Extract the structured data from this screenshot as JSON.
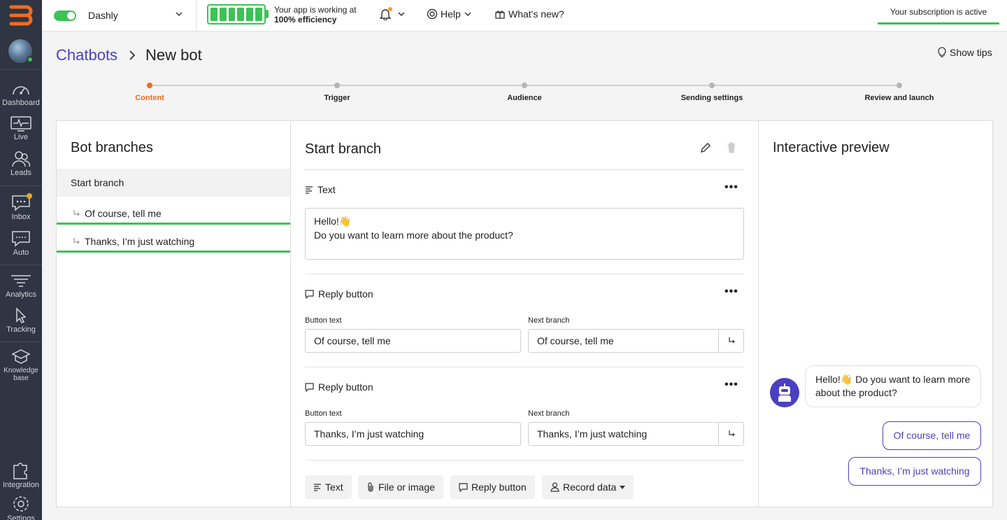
{
  "topbar": {
    "project_name": "Dashly",
    "efficiency_line1": "Your app is working at",
    "efficiency_line2": "100% efficiency",
    "help_label": "Help",
    "whats_new_label": "What's new?",
    "subscription_text": "Your subscription is active"
  },
  "sidebar": {
    "items": [
      {
        "label": "Dashboard",
        "icon": "speedometer-icon"
      },
      {
        "label": "Live",
        "icon": "pulse-monitor-icon"
      },
      {
        "label": "Leads",
        "icon": "users-icon"
      },
      {
        "label": "Inbox",
        "icon": "chat-icon"
      },
      {
        "label": "Auto",
        "icon": "auto-message-icon"
      },
      {
        "label": "Analytics",
        "icon": "funnel-icon"
      },
      {
        "label": "Tracking",
        "icon": "cursor-icon"
      },
      {
        "label": "Knowledge",
        "label2": "base",
        "icon": "book-icon"
      },
      {
        "label": "Integration",
        "icon": "puzzle-icon"
      },
      {
        "label": "Settings",
        "icon": "gear-icon"
      }
    ]
  },
  "header": {
    "breadcrumb_link": "Chatbots",
    "current": "New bot",
    "show_tips": "Show tips"
  },
  "stepper": {
    "steps": [
      "Content",
      "Trigger",
      "Audience",
      "Sending settings",
      "Review and launch"
    ],
    "active": 0
  },
  "branches_panel": {
    "title": "Bot branches",
    "items": [
      "Start branch",
      "Of course, tell me",
      "Thanks, I’m just watching"
    ]
  },
  "editor": {
    "title": "Start branch",
    "text_block": {
      "label": "Text",
      "line1": "Hello!👋",
      "line2": "Do you want to learn more about the product?"
    },
    "reply_blocks": [
      {
        "label": "Reply button",
        "button_text_label": "Button text",
        "button_text": "Of course, tell me",
        "next_branch_label": "Next branch",
        "next_branch": "Of course, tell me"
      },
      {
        "label": "Reply button",
        "button_text_label": "Button text",
        "button_text": "Thanks, I’m just watching",
        "next_branch_label": "Next branch",
        "next_branch": "Thanks, I’m just watching"
      }
    ],
    "add_buttons": [
      "Text",
      "File or image",
      "Reply button",
      "Record data"
    ]
  },
  "preview": {
    "title": "Interactive preview",
    "message": "Hello!👋 Do you want to learn more about the product?",
    "replies": [
      "Of course, tell me",
      "Thanks, I’m just watching"
    ],
    "accent_color": "#4b3fc2"
  },
  "colors": {
    "sidebar": "#2f3542",
    "success": "#3cc255",
    "active_step": "#f26b21",
    "brand": "#4b3fc2"
  }
}
